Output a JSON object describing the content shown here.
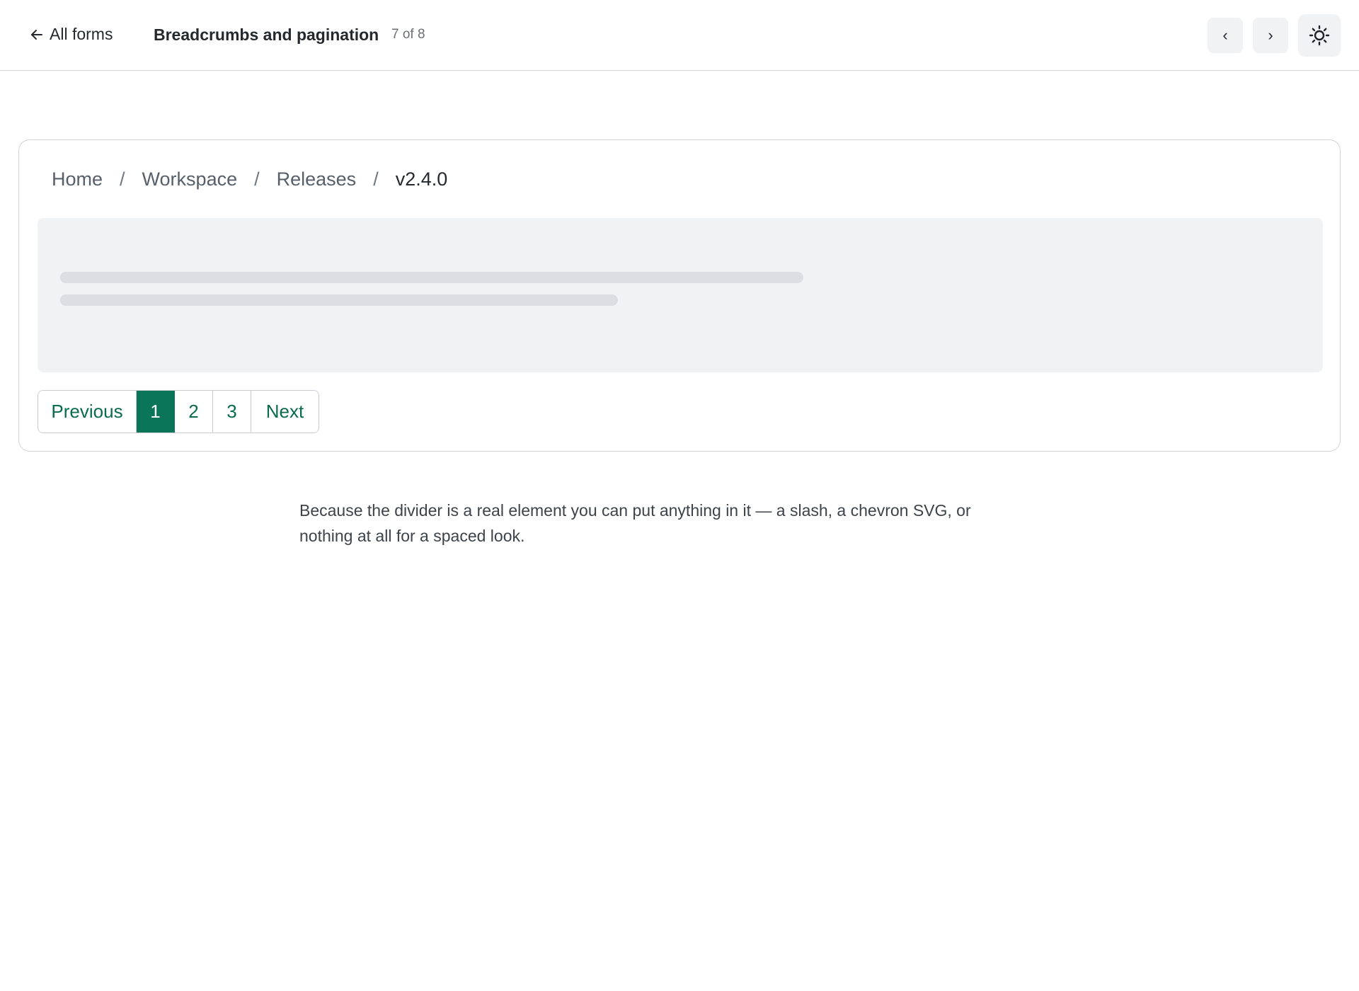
{
  "header": {
    "back_label": "All forms",
    "title": "Breadcrumbs and pagination",
    "counter": "7 of 8",
    "prev_icon": "chevron-left-icon",
    "prev_glyph": "‹",
    "next_icon": "chevron-right-icon",
    "next_glyph": "›",
    "theme_icon": "sun-icon"
  },
  "breadcrumb": {
    "items": [
      "Home",
      "Workspace",
      "Releases",
      "v2.4.0"
    ],
    "separator": "/"
  },
  "pagination": {
    "previous_label": "Previous",
    "pages": [
      "1",
      "2",
      "3"
    ],
    "active_page": "1",
    "next_label": "Next",
    "accent_color": "#0a7558"
  },
  "description": "Because the divider is a real element you can put anything in it — a slash, a chevron SVG, or nothing at all for a spaced look."
}
